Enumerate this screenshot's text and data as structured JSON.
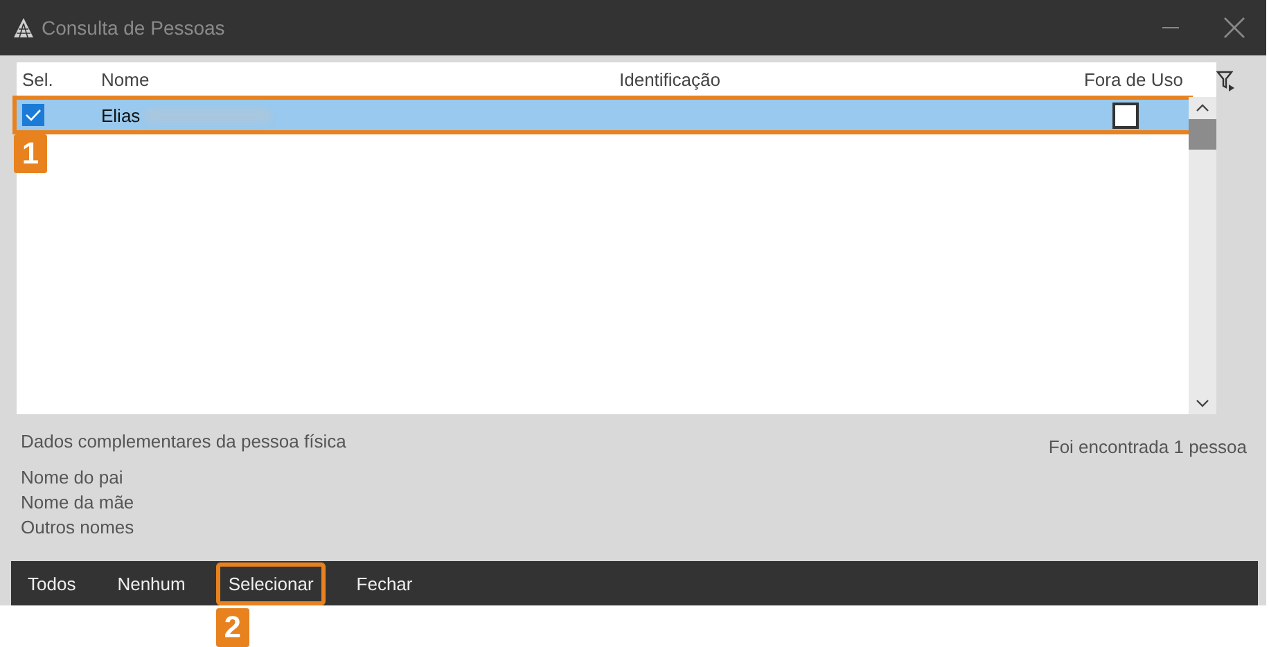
{
  "window": {
    "title": "Consulta de Pessoas"
  },
  "table": {
    "columns": [
      "Sel.",
      "Nome",
      "Identificação",
      "Fora de Uso"
    ],
    "rows": [
      {
        "selected": true,
        "checked": true,
        "name": "Elias",
        "name_redacted": true,
        "out_of_use": false
      }
    ]
  },
  "details": {
    "title": "Dados complementares da pessoa física",
    "fields": [
      "Nome do pai",
      "Nome da mãe",
      "Outros nomes"
    ]
  },
  "status": "Foi encontrada 1 pessoa",
  "buttons": [
    {
      "label": "Todos",
      "highlighted": false
    },
    {
      "label": "Nenhum",
      "highlighted": false
    },
    {
      "label": "Selecionar",
      "highlighted": true
    },
    {
      "label": "Fechar",
      "highlighted": false
    }
  ],
  "callouts": [
    {
      "label": "1"
    },
    {
      "label": "2"
    }
  ]
}
